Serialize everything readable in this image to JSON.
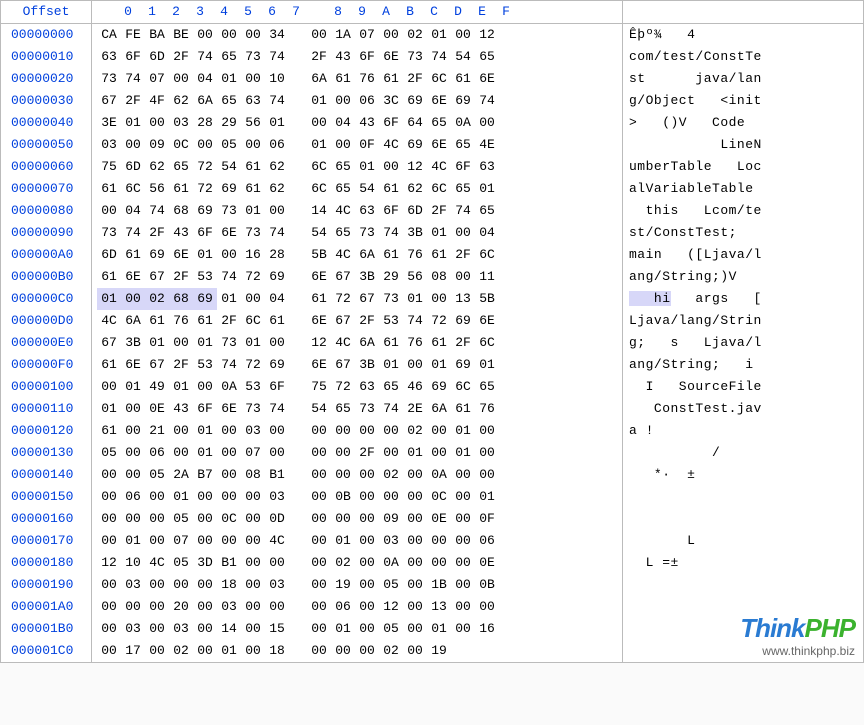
{
  "header": {
    "offset_label": "Offset",
    "cols": [
      "0",
      "1",
      "2",
      "3",
      "4",
      "5",
      "6",
      "7",
      "8",
      "9",
      "A",
      "B",
      "C",
      "D",
      "E",
      "F"
    ]
  },
  "highlight": {
    "row": 12,
    "start": 0,
    "end": 4
  },
  "rows": [
    {
      "offset": "00000000",
      "hex": [
        "CA",
        "FE",
        "BA",
        "BE",
        "00",
        "00",
        "00",
        "34",
        "00",
        "1A",
        "07",
        "00",
        "02",
        "01",
        "00",
        "12"
      ],
      "ascii": "Êþº¾   4        "
    },
    {
      "offset": "00000010",
      "hex": [
        "63",
        "6F",
        "6D",
        "2F",
        "74",
        "65",
        "73",
        "74",
        "2F",
        "43",
        "6F",
        "6E",
        "73",
        "74",
        "54",
        "65"
      ],
      "ascii": "com/test/ConstTe"
    },
    {
      "offset": "00000020",
      "hex": [
        "73",
        "74",
        "07",
        "00",
        "04",
        "01",
        "00",
        "10",
        "6A",
        "61",
        "76",
        "61",
        "2F",
        "6C",
        "61",
        "6E"
      ],
      "ascii": "st      java/lan"
    },
    {
      "offset": "00000030",
      "hex": [
        "67",
        "2F",
        "4F",
        "62",
        "6A",
        "65",
        "63",
        "74",
        "01",
        "00",
        "06",
        "3C",
        "69",
        "6E",
        "69",
        "74"
      ],
      "ascii": "g/Object   <init"
    },
    {
      "offset": "00000040",
      "hex": [
        "3E",
        "01",
        "00",
        "03",
        "28",
        "29",
        "56",
        "01",
        "00",
        "04",
        "43",
        "6F",
        "64",
        "65",
        "0A",
        "00"
      ],
      "ascii": ">   ()V   Code  "
    },
    {
      "offset": "00000050",
      "hex": [
        "03",
        "00",
        "09",
        "0C",
        "00",
        "05",
        "00",
        "06",
        "01",
        "00",
        "0F",
        "4C",
        "69",
        "6E",
        "65",
        "4E"
      ],
      "ascii": "           LineN"
    },
    {
      "offset": "00000060",
      "hex": [
        "75",
        "6D",
        "62",
        "65",
        "72",
        "54",
        "61",
        "62",
        "6C",
        "65",
        "01",
        "00",
        "12",
        "4C",
        "6F",
        "63"
      ],
      "ascii": "umberTable   Loc"
    },
    {
      "offset": "00000070",
      "hex": [
        "61",
        "6C",
        "56",
        "61",
        "72",
        "69",
        "61",
        "62",
        "6C",
        "65",
        "54",
        "61",
        "62",
        "6C",
        "65",
        "01"
      ],
      "ascii": "alVariableTable "
    },
    {
      "offset": "00000080",
      "hex": [
        "00",
        "04",
        "74",
        "68",
        "69",
        "73",
        "01",
        "00",
        "14",
        "4C",
        "63",
        "6F",
        "6D",
        "2F",
        "74",
        "65"
      ],
      "ascii": "  this   Lcom/te"
    },
    {
      "offset": "00000090",
      "hex": [
        "73",
        "74",
        "2F",
        "43",
        "6F",
        "6E",
        "73",
        "74",
        "54",
        "65",
        "73",
        "74",
        "3B",
        "01",
        "00",
        "04"
      ],
      "ascii": "st/ConstTest;   "
    },
    {
      "offset": "000000A0",
      "hex": [
        "6D",
        "61",
        "69",
        "6E",
        "01",
        "00",
        "16",
        "28",
        "5B",
        "4C",
        "6A",
        "61",
        "76",
        "61",
        "2F",
        "6C"
      ],
      "ascii": "main   ([Ljava/l"
    },
    {
      "offset": "000000B0",
      "hex": [
        "61",
        "6E",
        "67",
        "2F",
        "53",
        "74",
        "72",
        "69",
        "6E",
        "67",
        "3B",
        "29",
        "56",
        "08",
        "00",
        "11"
      ],
      "ascii": "ang/String;)V   "
    },
    {
      "offset": "000000C0",
      "hex": [
        "01",
        "00",
        "02",
        "68",
        "69",
        "01",
        "00",
        "04",
        "61",
        "72",
        "67",
        "73",
        "01",
        "00",
        "13",
        "5B"
      ],
      "ascii": "   hi   args   ["
    },
    {
      "offset": "000000D0",
      "hex": [
        "4C",
        "6A",
        "61",
        "76",
        "61",
        "2F",
        "6C",
        "61",
        "6E",
        "67",
        "2F",
        "53",
        "74",
        "72",
        "69",
        "6E"
      ],
      "ascii": "Ljava/lang/Strin"
    },
    {
      "offset": "000000E0",
      "hex": [
        "67",
        "3B",
        "01",
        "00",
        "01",
        "73",
        "01",
        "00",
        "12",
        "4C",
        "6A",
        "61",
        "76",
        "61",
        "2F",
        "6C"
      ],
      "ascii": "g;   s   Ljava/l"
    },
    {
      "offset": "000000F0",
      "hex": [
        "61",
        "6E",
        "67",
        "2F",
        "53",
        "74",
        "72",
        "69",
        "6E",
        "67",
        "3B",
        "01",
        "00",
        "01",
        "69",
        "01"
      ],
      "ascii": "ang/String;   i "
    },
    {
      "offset": "00000100",
      "hex": [
        "00",
        "01",
        "49",
        "01",
        "00",
        "0A",
        "53",
        "6F",
        "75",
        "72",
        "63",
        "65",
        "46",
        "69",
        "6C",
        "65"
      ],
      "ascii": "  I   SourceFile"
    },
    {
      "offset": "00000110",
      "hex": [
        "01",
        "00",
        "0E",
        "43",
        "6F",
        "6E",
        "73",
        "74",
        "54",
        "65",
        "73",
        "74",
        "2E",
        "6A",
        "61",
        "76"
      ],
      "ascii": "   ConstTest.jav"
    },
    {
      "offset": "00000120",
      "hex": [
        "61",
        "00",
        "21",
        "00",
        "01",
        "00",
        "03",
        "00",
        "00",
        "00",
        "00",
        "00",
        "02",
        "00",
        "01",
        "00"
      ],
      "ascii": "a !             "
    },
    {
      "offset": "00000130",
      "hex": [
        "05",
        "00",
        "06",
        "00",
        "01",
        "00",
        "07",
        "00",
        "00",
        "00",
        "2F",
        "00",
        "01",
        "00",
        "01",
        "00"
      ],
      "ascii": "          /     "
    },
    {
      "offset": "00000140",
      "hex": [
        "00",
        "00",
        "05",
        "2A",
        "B7",
        "00",
        "08",
        "B1",
        "00",
        "00",
        "00",
        "02",
        "00",
        "0A",
        "00",
        "00"
      ],
      "ascii": "   *·  ±        "
    },
    {
      "offset": "00000150",
      "hex": [
        "00",
        "06",
        "00",
        "01",
        "00",
        "00",
        "00",
        "03",
        "00",
        "0B",
        "00",
        "00",
        "00",
        "0C",
        "00",
        "01"
      ],
      "ascii": "                "
    },
    {
      "offset": "00000160",
      "hex": [
        "00",
        "00",
        "00",
        "05",
        "00",
        "0C",
        "00",
        "0D",
        "00",
        "00",
        "00",
        "09",
        "00",
        "0E",
        "00",
        "0F"
      ],
      "ascii": "                "
    },
    {
      "offset": "00000170",
      "hex": [
        "00",
        "01",
        "00",
        "07",
        "00",
        "00",
        "00",
        "4C",
        "00",
        "01",
        "00",
        "03",
        "00",
        "00",
        "00",
        "06"
      ],
      "ascii": "       L        "
    },
    {
      "offset": "00000180",
      "hex": [
        "12",
        "10",
        "4C",
        "05",
        "3D",
        "B1",
        "00",
        "00",
        "00",
        "02",
        "00",
        "0A",
        "00",
        "00",
        "00",
        "0E"
      ],
      "ascii": "  L =±          "
    },
    {
      "offset": "00000190",
      "hex": [
        "00",
        "03",
        "00",
        "00",
        "00",
        "18",
        "00",
        "03",
        "00",
        "19",
        "00",
        "05",
        "00",
        "1B",
        "00",
        "0B"
      ],
      "ascii": "                "
    },
    {
      "offset": "000001A0",
      "hex": [
        "00",
        "00",
        "00",
        "20",
        "00",
        "03",
        "00",
        "00",
        "00",
        "06",
        "00",
        "12",
        "00",
        "13",
        "00",
        "00"
      ],
      "ascii": "                "
    },
    {
      "offset": "000001B0",
      "hex": [
        "00",
        "03",
        "00",
        "03",
        "00",
        "14",
        "00",
        "15",
        "00",
        "01",
        "00",
        "05",
        "00",
        "01",
        "00",
        "16"
      ],
      "ascii": "                "
    },
    {
      "offset": "000001C0",
      "hex": [
        "00",
        "17",
        "00",
        "02",
        "00",
        "01",
        "00",
        "18",
        "00",
        "00",
        "00",
        "02",
        "00",
        "19"
      ],
      "ascii": "              "
    }
  ],
  "watermark": {
    "brand_a": "Think",
    "brand_b": "PHP",
    "url": "www.thinkphp.biz"
  }
}
